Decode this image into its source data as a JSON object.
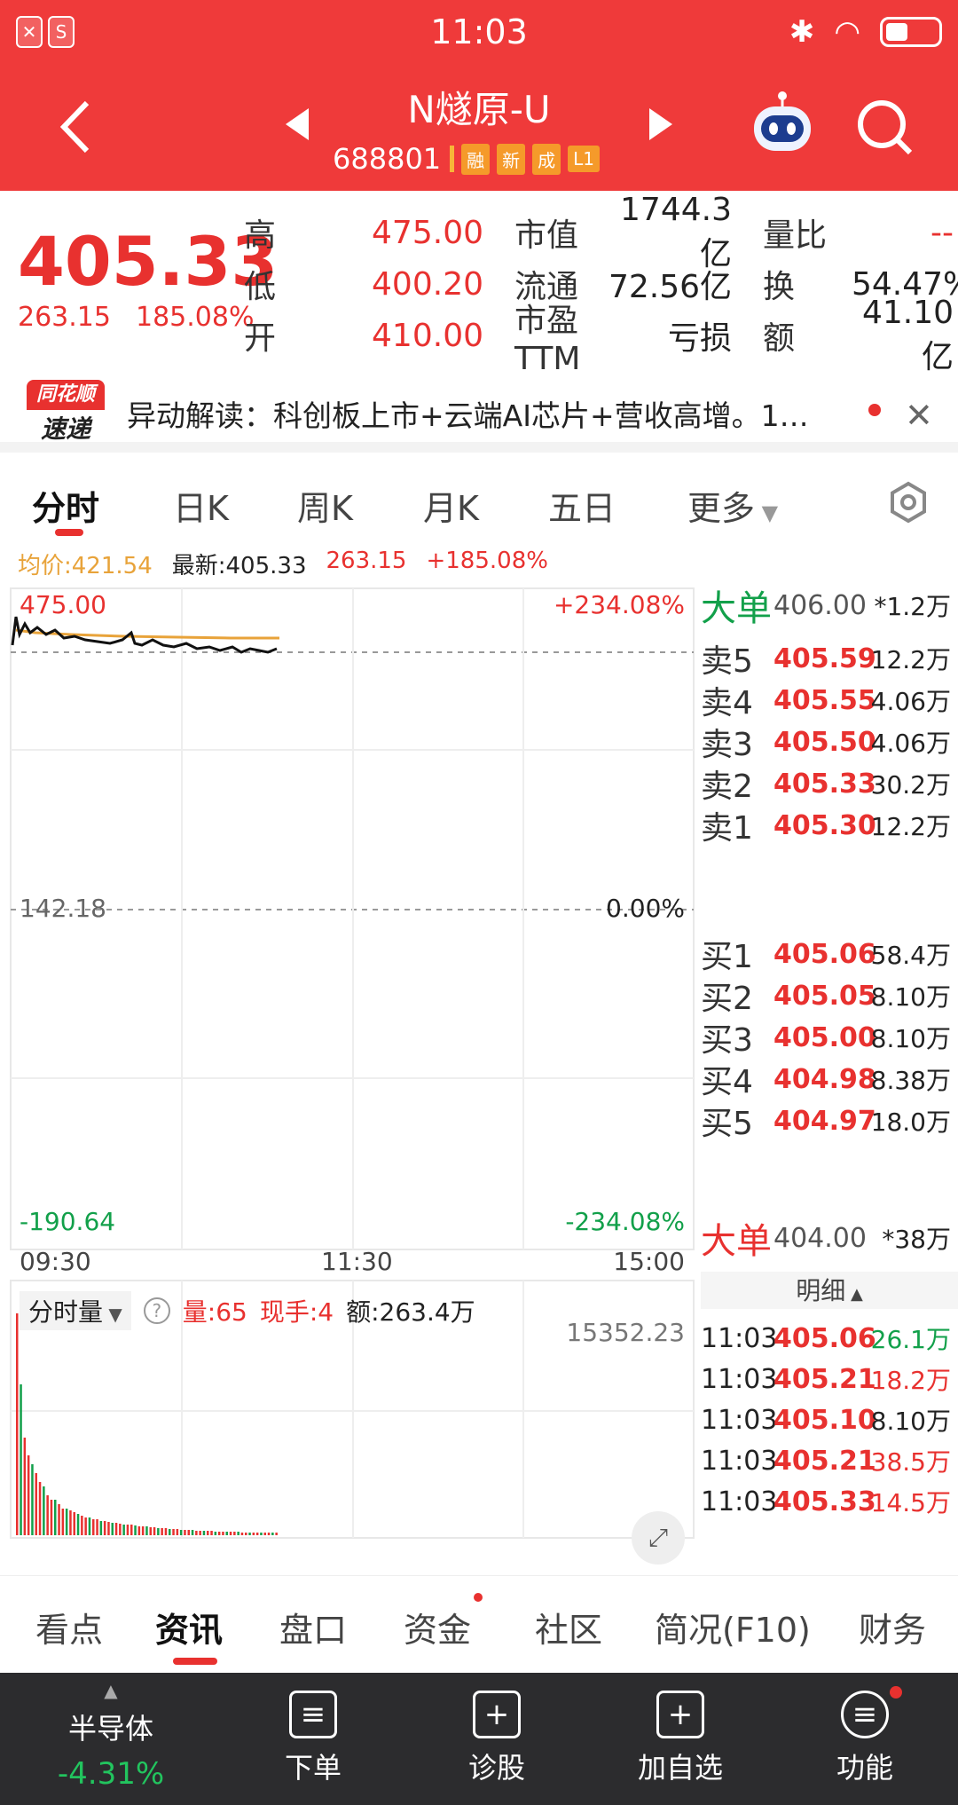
{
  "status_bar": {
    "time": "11:03"
  },
  "header": {
    "title": "N燧原-U",
    "code": "688801",
    "tags": [
      "融",
      "新",
      "成",
      "L1"
    ]
  },
  "quote": {
    "price": "405.33",
    "change": "263.15",
    "change_pct": "185.08%",
    "rows": [
      {
        "l1": "高",
        "v1": "475.00",
        "l2": "市值",
        "v2": "1744.3亿",
        "l3": "量比",
        "v3": "--"
      },
      {
        "l1": "低",
        "v1": "400.20",
        "l2": "流通",
        "v2": "72.56亿",
        "l3": "换",
        "v3": "54.47%"
      },
      {
        "l1": "开",
        "v1": "410.00",
        "l2": "市盈TTM",
        "v2": "亏损",
        "l3": "额",
        "v3": "41.10亿"
      }
    ]
  },
  "news": {
    "logo_top": "同花顺",
    "logo_bottom": "速递",
    "text": "异动解读：科创板上市+云端AI芯片+营收高增。1…"
  },
  "tabs": [
    "分时",
    "日K",
    "周K",
    "月K",
    "五日",
    "更多"
  ],
  "legend": {
    "avg": "均价:421.54",
    "latest": "最新:405.33",
    "chg": "263.15",
    "pct": "+185.08%"
  },
  "chart": {
    "top_price": "475.00",
    "top_pct": "+234.08%",
    "mid_price": "142.18",
    "mid_pct": "0.00%",
    "bot_price": "-190.64",
    "bot_pct": "-234.08%",
    "x_ticks": [
      "09:30",
      "11:30",
      "15:00"
    ],
    "vol_label": "分时量",
    "vol": "量:65",
    "hand": "现手:4",
    "amount": "额:263.4万",
    "vol_max": "15352.23"
  },
  "book": {
    "big_sell": {
      "label": "大单",
      "price": "406.00",
      "vol": "*1.2万"
    },
    "asks": [
      {
        "label": "卖5",
        "price": "405.59",
        "vol": "12.2万"
      },
      {
        "label": "卖4",
        "price": "405.55",
        "vol": "4.06万"
      },
      {
        "label": "卖3",
        "price": "405.50",
        "vol": "4.06万"
      },
      {
        "label": "卖2",
        "price": "405.33",
        "vol": "30.2万"
      },
      {
        "label": "卖1",
        "price": "405.30",
        "vol": "12.2万"
      }
    ],
    "bids": [
      {
        "label": "买1",
        "price": "405.06",
        "vol": "58.4万"
      },
      {
        "label": "买2",
        "price": "405.05",
        "vol": "8.10万"
      },
      {
        "label": "买3",
        "price": "405.00",
        "vol": "8.10万"
      },
      {
        "label": "买4",
        "price": "404.98",
        "vol": "8.38万"
      },
      {
        "label": "买5",
        "price": "404.97",
        "vol": "18.0万"
      }
    ],
    "big_buy": {
      "label": "大单",
      "price": "404.00",
      "vol": "*38万"
    },
    "detail_label": "明细",
    "trades": [
      {
        "time": "11:03",
        "price": "405.06",
        "vol": "26.1万",
        "color": "#12a04a"
      },
      {
        "time": "11:03",
        "price": "405.21",
        "vol": "18.2万",
        "color": "#e8312f"
      },
      {
        "time": "11:03",
        "price": "405.10",
        "vol": "8.10万",
        "color": "#222222"
      },
      {
        "time": "11:03",
        "price": "405.21",
        "vol": "38.5万",
        "color": "#e8312f"
      },
      {
        "time": "11:03",
        "price": "405.33",
        "vol": "14.5万",
        "color": "#e8312f"
      }
    ]
  },
  "bottom_tabs": [
    "看点",
    "资讯",
    "盘口",
    "资金",
    "社区",
    "简况(F10)",
    "财务"
  ],
  "bottom_bar": {
    "sector": "半导体",
    "sector_pct": "-4.31%",
    "items": [
      "下单",
      "诊股",
      "加自选",
      "功能"
    ]
  },
  "colors": {
    "header": "#ef3a3a",
    "up": "#e8312f",
    "down": "#12a04a",
    "avg_line": "#e8a33a"
  }
}
